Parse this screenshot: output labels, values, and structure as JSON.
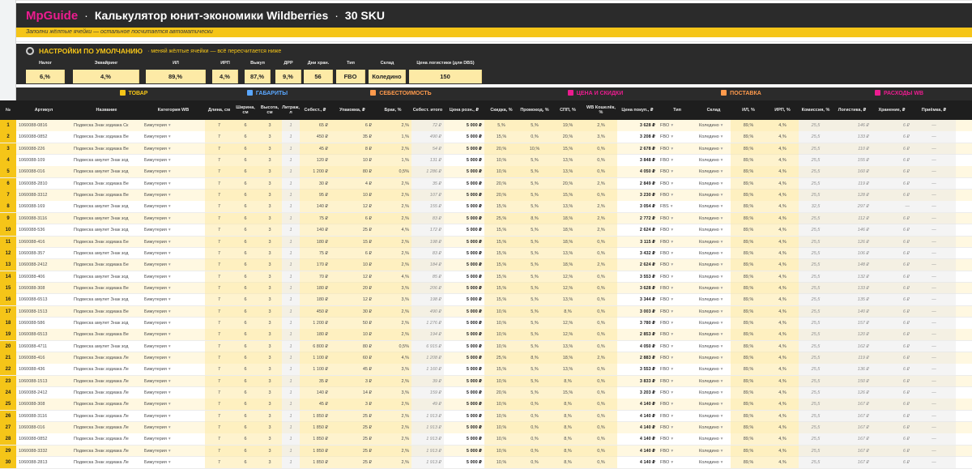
{
  "title": {
    "brand": "MpGuide",
    "separator": "·",
    "text": "Калькулятор юнит-экономики Wildberries",
    "sku": "30 SKU"
  },
  "hint": "Заполни жёлтые ячейки — остальное посчитается автоматически",
  "settings": {
    "title": "НАСТРОЙКИ ПО УМОЛЧАНИЮ",
    "note": "· меняй жёлтые ячейки — всё пересчитается ниже",
    "headers": [
      "Налог",
      "Эквайринг",
      "ИЛ",
      "ИРП",
      "Выкуп",
      "ДРР",
      "Дни хран.",
      "Тип",
      "Склад",
      "Цена логистики (для DBS)"
    ],
    "values": [
      "6,%",
      "4,%",
      "89,%",
      "4,%",
      "87,%",
      "9,%",
      "56",
      "FBO",
      "Коледино",
      "150"
    ]
  },
  "sections": [
    {
      "label": "ТОВАР",
      "color": "#f5c518"
    },
    {
      "label": "ГАБАРИТЫ",
      "color": "#5aa7ff"
    },
    {
      "label": "СЕБЕСТОИМОСТЬ",
      "color": "#ff9a4c"
    },
    {
      "label": "ЦЕНА И СКИДКИ",
      "color": "#ec1c8f"
    },
    {
      "label": "ПОСТАВКА",
      "color": "#ff9a4c"
    },
    {
      "label": "РАСХОДЫ WB",
      "color": "#ec1c8f"
    }
  ],
  "columns": [
    "№",
    "Артикул",
    "Название",
    "Категория WB",
    "Длина, см",
    "Ширина, см",
    "Высота, см",
    "Литраж, л",
    "Себест., ₽",
    "Упаковка, ₽",
    "Брак, %",
    "Себест. итого",
    "Цена розн., ₽",
    "Скидка, %",
    "Промокод, %",
    "СПП, %",
    "WB Кошелёк, %",
    "Цена покуп., ₽",
    "Тип",
    "Склад",
    "ИЛ, %",
    "ИРП, %",
    "Комиссия, %",
    "Логистика, ₽",
    "Хранение, ₽",
    "Приёмка, ₽"
  ],
  "rows": [
    {
      "n": "1",
      "sku": "1060088-0816",
      "name": "Подвеска Знак зодиака Ск",
      "cat": "Бижутерия",
      "l": "7",
      "w": "6",
      "h": "3",
      "lit": "1",
      "cost": "65 ₽",
      "pack": "6 ₽",
      "def": "2,%",
      "tot": "72 ₽",
      "price": "5 000 ₽",
      "disc": "5,%",
      "promo": "5,%",
      "spp": "19,%",
      "wal": "2,%",
      "buy": "3 628 ₽",
      "type": "FBO",
      "wh": "Коледино",
      "il": "89,%",
      "irp": "4,%",
      "com": "25,5",
      "log": "146 ₽",
      "st": "6 ₽",
      "acc": "—"
    },
    {
      "n": "2",
      "sku": "1060088-0852",
      "name": "Подвеска Знак зодиака Ве",
      "cat": "Бижутерия",
      "l": "7",
      "w": "6",
      "h": "3",
      "lit": "1",
      "cost": "450 ₽",
      "pack": "35 ₽",
      "def": "1,%",
      "tot": "490 ₽",
      "price": "5 000 ₽",
      "disc": "15,%",
      "promo": "0,%",
      "spp": "20,%",
      "wal": "3,%",
      "buy": "3 208 ₽",
      "type": "FBO",
      "wh": "Коледино",
      "il": "89,%",
      "irp": "4,%",
      "com": "25,5",
      "log": "133 ₽",
      "st": "6 ₽",
      "acc": "—"
    },
    {
      "n": "3",
      "sku": "1060088-226",
      "name": "Подвеска Знак зодиака Ве",
      "cat": "Бижутерия",
      "l": "7",
      "w": "6",
      "h": "3",
      "lit": "1",
      "cost": "45 ₽",
      "pack": "8 ₽",
      "def": "2,%",
      "tot": "54 ₽",
      "price": "5 000 ₽",
      "disc": "20,%",
      "promo": "10,%",
      "spp": "15,%",
      "wal": "0,%",
      "buy": "2 678 ₽",
      "type": "FBO",
      "wh": "Коледино",
      "il": "89,%",
      "irp": "4,%",
      "com": "25,5",
      "log": "110 ₽",
      "st": "6 ₽",
      "acc": "—"
    },
    {
      "n": "4",
      "sku": "1060088-109",
      "name": "Подвеска амулет Знак зод",
      "cat": "Бижутерия",
      "l": "7",
      "w": "6",
      "h": "3",
      "lit": "1",
      "cost": "120 ₽",
      "pack": "10 ₽",
      "def": "1,%",
      "tot": "131 ₽",
      "price": "5 000 ₽",
      "disc": "10,%",
      "promo": "5,%",
      "spp": "13,%",
      "wal": "0,%",
      "buy": "3 848 ₽",
      "type": "FBO",
      "wh": "Коледино",
      "il": "89,%",
      "irp": "4,%",
      "com": "25,5",
      "log": "155 ₽",
      "st": "6 ₽",
      "acc": "—"
    },
    {
      "n": "5",
      "sku": "1060088-016",
      "name": "Подвеска амулет Знак зод",
      "cat": "Бижутерия",
      "l": "7",
      "w": "6",
      "h": "3",
      "lit": "1",
      "cost": "1 200 ₽",
      "pack": "80 ₽",
      "def": "0,5%",
      "tot": "1 286 ₽",
      "price": "5 000 ₽",
      "disc": "10,%",
      "promo": "5,%",
      "spp": "13,%",
      "wal": "0,%",
      "buy": "4 050 ₽",
      "type": "FBO",
      "wh": "Коледино",
      "il": "89,%",
      "irp": "4,%",
      "com": "25,5",
      "log": "160 ₽",
      "st": "6 ₽",
      "acc": "—"
    },
    {
      "n": "6",
      "sku": "1060088-2810",
      "name": "Подвеска Знак зодиака Ве",
      "cat": "Бижутерия",
      "l": "7",
      "w": "6",
      "h": "3",
      "lit": "1",
      "cost": "30 ₽",
      "pack": "4 ₽",
      "def": "2,%",
      "tot": "35 ₽",
      "price": "5 000 ₽",
      "disc": "20,%",
      "promo": "5,%",
      "spp": "20,%",
      "wal": "2,%",
      "buy": "2 849 ₽",
      "type": "FBO",
      "wh": "Коледино",
      "il": "89,%",
      "irp": "4,%",
      "com": "25,5",
      "log": "119 ₽",
      "st": "6 ₽",
      "acc": "—"
    },
    {
      "n": "7",
      "sku": "1060088-3312",
      "name": "Подвеска Знак зодиака Ве",
      "cat": "Бижутерия",
      "l": "7",
      "w": "6",
      "h": "3",
      "lit": "1",
      "cost": "95 ₽",
      "pack": "10 ₽",
      "def": "2,%",
      "tot": "107 ₽",
      "price": "5 000 ₽",
      "disc": "20,%",
      "promo": "5,%",
      "spp": "15,%",
      "wal": "0,%",
      "buy": "3 230 ₽",
      "type": "FBO",
      "wh": "Коледино",
      "il": "89,%",
      "irp": "4,%",
      "com": "25,5",
      "log": "128 ₽",
      "st": "6 ₽",
      "acc": "—"
    },
    {
      "n": "8",
      "sku": "1060088-169",
      "name": "Подвеска амулет Знак зод",
      "cat": "Бижутерия",
      "l": "7",
      "w": "6",
      "h": "3",
      "lit": "1",
      "cost": "140 ₽",
      "pack": "12 ₽",
      "def": "2,%",
      "tot": "155 ₽",
      "price": "5 000 ₽",
      "disc": "15,%",
      "promo": "5,%",
      "spp": "13,%",
      "wal": "2,%",
      "buy": "3 054 ₽",
      "type": "FBS",
      "wh": "Коледино",
      "il": "89,%",
      "irp": "4,%",
      "com": "32,5",
      "log": "297 ₽",
      "st": "—",
      "acc": "—"
    },
    {
      "n": "9",
      "sku": "1060088-3116",
      "name": "Подвеска амулет Знак зод",
      "cat": "Бижутерия",
      "l": "7",
      "w": "6",
      "h": "3",
      "lit": "1",
      "cost": "75 ₽",
      "pack": "6 ₽",
      "def": "2,%",
      "tot": "83 ₽",
      "price": "5 000 ₽",
      "disc": "25,%",
      "promo": "8,%",
      "spp": "18,%",
      "wal": "2,%",
      "buy": "2 772 ₽",
      "type": "FBO",
      "wh": "Коледино",
      "il": "89,%",
      "irp": "4,%",
      "com": "25,5",
      "log": "112 ₽",
      "st": "6 ₽",
      "acc": "—"
    },
    {
      "n": "10",
      "sku": "1060088-536",
      "name": "Подвеска амулет Знак зод",
      "cat": "Бижутерия",
      "l": "7",
      "w": "6",
      "h": "3",
      "lit": "1",
      "cost": "140 ₽",
      "pack": "25 ₽",
      "def": "4,%",
      "tot": "172 ₽",
      "price": "5 000 ₽",
      "disc": "15,%",
      "promo": "5,%",
      "spp": "18,%",
      "wal": "2,%",
      "buy": "2 624 ₽",
      "type": "FBO",
      "wh": "Коледино",
      "il": "89,%",
      "irp": "4,%",
      "com": "25,5",
      "log": "146 ₽",
      "st": "6 ₽",
      "acc": "—"
    },
    {
      "n": "11",
      "sku": "1060088-416",
      "name": "Подвеска Знак зодиака Бе",
      "cat": "Бижутерия",
      "l": "7",
      "w": "6",
      "h": "3",
      "lit": "1",
      "cost": "180 ₽",
      "pack": "15 ₽",
      "def": "2,%",
      "tot": "198 ₽",
      "price": "5 000 ₽",
      "disc": "15,%",
      "promo": "5,%",
      "spp": "18,%",
      "wal": "0,%",
      "buy": "3 115 ₽",
      "type": "FBO",
      "wh": "Коледино",
      "il": "89,%",
      "irp": "4,%",
      "com": "25,5",
      "log": "126 ₽",
      "st": "6 ₽",
      "acc": "—"
    },
    {
      "n": "12",
      "sku": "1060088-357",
      "name": "Подвеска амулет Знак зод",
      "cat": "Бижутерия",
      "l": "7",
      "w": "6",
      "h": "3",
      "lit": "1",
      "cost": "75 ₽",
      "pack": "6 ₽",
      "def": "2,%",
      "tot": "83 ₽",
      "price": "5 000 ₽",
      "disc": "15,%",
      "promo": "5,%",
      "spp": "13,%",
      "wal": "0,%",
      "buy": "3 432 ₽",
      "type": "FBO",
      "wh": "Коледино",
      "il": "89,%",
      "irp": "4,%",
      "com": "25,5",
      "log": "106 ₽",
      "st": "6 ₽",
      "acc": "—"
    },
    {
      "n": "13",
      "sku": "1060088-2412",
      "name": "Подвеска Знак зодиака Бе",
      "cat": "Бижутерия",
      "l": "7",
      "w": "6",
      "h": "3",
      "lit": "1",
      "cost": "170 ₽",
      "pack": "10 ₽",
      "def": "2,%",
      "tot": "184 ₽",
      "price": "5 000 ₽",
      "disc": "15,%",
      "promo": "5,%",
      "spp": "18,%",
      "wal": "2,%",
      "buy": "2 624 ₽",
      "type": "FBO",
      "wh": "Коледино",
      "il": "89,%",
      "irp": "4,%",
      "com": "25,5",
      "log": "148 ₽",
      "st": "6 ₽",
      "acc": "—"
    },
    {
      "n": "14",
      "sku": "1060088-406",
      "name": "Подвеска амулет Знак зод",
      "cat": "Бижутерия",
      "l": "7",
      "w": "6",
      "h": "3",
      "lit": "1",
      "cost": "70 ₽",
      "pack": "12 ₽",
      "def": "4,%",
      "tot": "85 ₽",
      "price": "5 000 ₽",
      "disc": "15,%",
      "promo": "5,%",
      "spp": "12,%",
      "wal": "0,%",
      "buy": "3 553 ₽",
      "type": "FBO",
      "wh": "Коледино",
      "il": "89,%",
      "irp": "4,%",
      "com": "25,5",
      "log": "132 ₽",
      "st": "6 ₽",
      "acc": "—"
    },
    {
      "n": "15",
      "sku": "1060088-308",
      "name": "Подвеска Знак зодиака Ве",
      "cat": "Бижутерия",
      "l": "7",
      "w": "6",
      "h": "3",
      "lit": "1",
      "cost": "180 ₽",
      "pack": "20 ₽",
      "def": "3,%",
      "tot": "206 ₽",
      "price": "5 000 ₽",
      "disc": "15,%",
      "promo": "5,%",
      "spp": "12,%",
      "wal": "0,%",
      "buy": "3 628 ₽",
      "type": "FBO",
      "wh": "Коледино",
      "il": "89,%",
      "irp": "4,%",
      "com": "25,5",
      "log": "133 ₽",
      "st": "6 ₽",
      "acc": "—"
    },
    {
      "n": "16",
      "sku": "1060088-6513",
      "name": "Подвеска амулет Знак зод",
      "cat": "Бижутерия",
      "l": "7",
      "w": "6",
      "h": "3",
      "lit": "1",
      "cost": "180 ₽",
      "pack": "12 ₽",
      "def": "3,%",
      "tot": "198 ₽",
      "price": "5 000 ₽",
      "disc": "15,%",
      "promo": "5,%",
      "spp": "13,%",
      "wal": "0,%",
      "buy": "3 344 ₽",
      "type": "FBO",
      "wh": "Коледино",
      "il": "89,%",
      "irp": "4,%",
      "com": "25,5",
      "log": "135 ₽",
      "st": "6 ₽",
      "acc": "—"
    },
    {
      "n": "17",
      "sku": "1060088-1513",
      "name": "Подвеска Знак зодиака Ве",
      "cat": "Бижутерия",
      "l": "7",
      "w": "6",
      "h": "3",
      "lit": "1",
      "cost": "450 ₽",
      "pack": "30 ₽",
      "def": "2,%",
      "tot": "490 ₽",
      "price": "5 000 ₽",
      "disc": "10,%",
      "promo": "5,%",
      "spp": "8,%",
      "wal": "0,%",
      "buy": "3 003 ₽",
      "type": "FBO",
      "wh": "Коледино",
      "il": "89,%",
      "irp": "4,%",
      "com": "25,5",
      "log": "140 ₽",
      "st": "6 ₽",
      "acc": "—"
    },
    {
      "n": "18",
      "sku": "1060088-586",
      "name": "Подвеска амулет Знак зод",
      "cat": "Бижутерия",
      "l": "7",
      "w": "6",
      "h": "3",
      "lit": "1",
      "cost": "1 200 ₽",
      "pack": "50 ₽",
      "def": "2,%",
      "tot": "1 276 ₽",
      "price": "5 000 ₽",
      "disc": "10,%",
      "promo": "5,%",
      "spp": "12,%",
      "wal": "0,%",
      "buy": "3 780 ₽",
      "type": "FBO",
      "wh": "Коледино",
      "il": "89,%",
      "irp": "4,%",
      "com": "25,5",
      "log": "157 ₽",
      "st": "6 ₽",
      "acc": "—"
    },
    {
      "n": "19",
      "sku": "1060088-6513",
      "name": "Подвеска Знак зодиака Ве",
      "cat": "Бижутерия",
      "l": "7",
      "w": "6",
      "h": "3",
      "lit": "1",
      "cost": "180 ₽",
      "pack": "10 ₽",
      "def": "2,%",
      "tot": "194 ₽",
      "price": "5 000 ₽",
      "disc": "10,%",
      "promo": "5,%",
      "spp": "12,%",
      "wal": "0,%",
      "buy": "2 853 ₽",
      "type": "FBO",
      "wh": "Коледино",
      "il": "89,%",
      "irp": "4,%",
      "com": "25,5",
      "log": "120 ₽",
      "st": "6 ₽",
      "acc": "—"
    },
    {
      "n": "20",
      "sku": "1060088-4711",
      "name": "Подвеска амулет Знак зод",
      "cat": "Бижутерия",
      "l": "7",
      "w": "6",
      "h": "3",
      "lit": "1",
      "cost": "6 800 ₽",
      "pack": "80 ₽",
      "def": "0,5%",
      "tot": "6 915 ₽",
      "price": "5 000 ₽",
      "disc": "10,%",
      "promo": "5,%",
      "spp": "13,%",
      "wal": "0,%",
      "buy": "4 050 ₽",
      "type": "FBO",
      "wh": "Коледино",
      "il": "89,%",
      "irp": "4,%",
      "com": "25,5",
      "log": "162 ₽",
      "st": "6 ₽",
      "acc": "—"
    },
    {
      "n": "21",
      "sku": "1060088-416",
      "name": "Подвеска Знак зодиака Ле",
      "cat": "Бижутерия",
      "l": "7",
      "w": "6",
      "h": "3",
      "lit": "1",
      "cost": "1 100 ₽",
      "pack": "60 ₽",
      "def": "4,%",
      "tot": "1 208 ₽",
      "price": "5 000 ₽",
      "disc": "25,%",
      "promo": "8,%",
      "spp": "18,%",
      "wal": "2,%",
      "buy": "2 883 ₽",
      "type": "FBO",
      "wh": "Коледино",
      "il": "89,%",
      "irp": "4,%",
      "com": "25,5",
      "log": "119 ₽",
      "st": "6 ₽",
      "acc": "—"
    },
    {
      "n": "22",
      "sku": "1060088-436",
      "name": "Подвеска Знак зодиака Ле",
      "cat": "Бижутерия",
      "l": "7",
      "w": "6",
      "h": "3",
      "lit": "1",
      "cost": "1 100 ₽",
      "pack": "45 ₽",
      "def": "3,%",
      "tot": "1 160 ₽",
      "price": "5 000 ₽",
      "disc": "15,%",
      "promo": "5,%",
      "spp": "13,%",
      "wal": "0,%",
      "buy": "3 553 ₽",
      "type": "FBO",
      "wh": "Коледино",
      "il": "89,%",
      "irp": "4,%",
      "com": "25,5",
      "log": "136 ₽",
      "st": "6 ₽",
      "acc": "—"
    },
    {
      "n": "23",
      "sku": "1060088-1513",
      "name": "Подвеска Знак зодиака Ле",
      "cat": "Бижутерия",
      "l": "7",
      "w": "6",
      "h": "3",
      "lit": "1",
      "cost": "35 ₽",
      "pack": "3 ₽",
      "def": "2,%",
      "tot": "39 ₽",
      "price": "5 000 ₽",
      "disc": "10,%",
      "promo": "5,%",
      "spp": "8,%",
      "wal": "0,%",
      "buy": "3 833 ₽",
      "type": "FBO",
      "wh": "Коледино",
      "il": "89,%",
      "irp": "4,%",
      "com": "25,5",
      "log": "150 ₽",
      "st": "6 ₽",
      "acc": "—"
    },
    {
      "n": "24",
      "sku": "1060088-2412",
      "name": "Подвеска Знак зодиака Ле",
      "cat": "Бижутерия",
      "l": "7",
      "w": "6",
      "h": "3",
      "lit": "1",
      "cost": "140 ₽",
      "pack": "14 ₽",
      "def": "3,%",
      "tot": "159 ₽",
      "price": "5 000 ₽",
      "disc": "20,%",
      "promo": "5,%",
      "spp": "15,%",
      "wal": "0,%",
      "buy": "3 203 ₽",
      "type": "FBO",
      "wh": "Коледино",
      "il": "89,%",
      "irp": "4,%",
      "com": "25,5",
      "log": "126 ₽",
      "st": "6 ₽",
      "acc": "—"
    },
    {
      "n": "25",
      "sku": "1060088-308",
      "name": "Подвеска Знак зодиака Ле",
      "cat": "Бижутерия",
      "l": "7",
      "w": "6",
      "h": "3",
      "lit": "1",
      "cost": "45 ₽",
      "pack": "3 ₽",
      "def": "2,%",
      "tot": "49 ₽",
      "price": "5 000 ₽",
      "disc": "10,%",
      "promo": "0,%",
      "spp": "8,%",
      "wal": "0,%",
      "buy": "4 140 ₽",
      "type": "FBO",
      "wh": "Коледино",
      "il": "89,%",
      "irp": "4,%",
      "com": "25,5",
      "log": "167 ₽",
      "st": "6 ₽",
      "acc": "—"
    },
    {
      "n": "26",
      "sku": "1060088-3116",
      "name": "Подвеска Знак зодиака Ле",
      "cat": "Бижутерия",
      "l": "7",
      "w": "6",
      "h": "3",
      "lit": "1",
      "cost": "1 850 ₽",
      "pack": "25 ₽",
      "def": "2,%",
      "tot": "1 913 ₽",
      "price": "5 000 ₽",
      "disc": "10,%",
      "promo": "0,%",
      "spp": "8,%",
      "wal": "0,%",
      "buy": "4 140 ₽",
      "type": "FBO",
      "wh": "Коледино",
      "il": "89,%",
      "irp": "4,%",
      "com": "25,5",
      "log": "167 ₽",
      "st": "6 ₽",
      "acc": "—"
    },
    {
      "n": "27",
      "sku": "1060088-016",
      "name": "Подвеска Знак зодиака Ле",
      "cat": "Бижутерия",
      "l": "7",
      "w": "6",
      "h": "3",
      "lit": "1",
      "cost": "1 850 ₽",
      "pack": "25 ₽",
      "def": "2,%",
      "tot": "1 913 ₽",
      "price": "5 000 ₽",
      "disc": "10,%",
      "promo": "0,%",
      "spp": "8,%",
      "wal": "0,%",
      "buy": "4 140 ₽",
      "type": "FBO",
      "wh": "Коледино",
      "il": "89,%",
      "irp": "4,%",
      "com": "25,5",
      "log": "167 ₽",
      "st": "6 ₽",
      "acc": "—"
    },
    {
      "n": "28",
      "sku": "1060088-0852",
      "name": "Подвеска Знак зодиака Ле",
      "cat": "Бижутерия",
      "l": "7",
      "w": "6",
      "h": "3",
      "lit": "1",
      "cost": "1 850 ₽",
      "pack": "25 ₽",
      "def": "2,%",
      "tot": "1 913 ₽",
      "price": "5 000 ₽",
      "disc": "10,%",
      "promo": "0,%",
      "spp": "8,%",
      "wal": "0,%",
      "buy": "4 140 ₽",
      "type": "FBO",
      "wh": "Коледино",
      "il": "89,%",
      "irp": "4,%",
      "com": "25,5",
      "log": "167 ₽",
      "st": "6 ₽",
      "acc": "—"
    },
    {
      "n": "29",
      "sku": "1060088-3332",
      "name": "Подвеска Знак зодиака Ле",
      "cat": "Бижутерия",
      "l": "7",
      "w": "6",
      "h": "3",
      "lit": "1",
      "cost": "1 850 ₽",
      "pack": "25 ₽",
      "def": "2,%",
      "tot": "1 913 ₽",
      "price": "5 000 ₽",
      "disc": "10,%",
      "promo": "0,%",
      "spp": "8,%",
      "wal": "0,%",
      "buy": "4 140 ₽",
      "type": "FBO",
      "wh": "Коледино",
      "il": "89,%",
      "irp": "4,%",
      "com": "25,5",
      "log": "167 ₽",
      "st": "6 ₽",
      "acc": "—"
    },
    {
      "n": "30",
      "sku": "1060088-2813",
      "name": "Подвеска Знак зодиака Ле",
      "cat": "Бижутерия",
      "l": "7",
      "w": "6",
      "h": "3",
      "lit": "1",
      "cost": "1 850 ₽",
      "pack": "25 ₽",
      "def": "2,%",
      "tot": "1 913 ₽",
      "price": "5 000 ₽",
      "disc": "10,%",
      "promo": "0,%",
      "spp": "8,%",
      "wal": "0,%",
      "buy": "4 140 ₽",
      "type": "FBO",
      "wh": "Коледино",
      "il": "89,%",
      "irp": "4,%",
      "com": "25,5",
      "log": "167 ₽",
      "st": "6 ₽",
      "acc": "—"
    }
  ]
}
